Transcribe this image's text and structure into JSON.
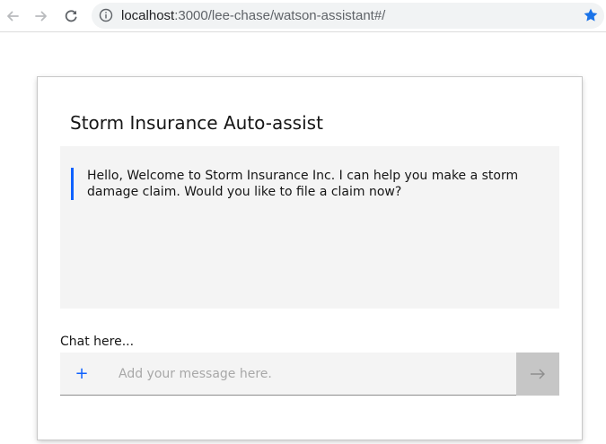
{
  "browser": {
    "url_host": "localhost",
    "url_path": ":3000/lee-chase/watson-assistant#/",
    "icons": {
      "back": "arrow-left-icon",
      "forward": "arrow-right-icon",
      "reload": "reload-icon",
      "info": "info-icon",
      "bookmark": "star-icon"
    }
  },
  "assistant": {
    "title": "Storm Insurance Auto-assist",
    "messages": [
      {
        "from": "bot",
        "text": "Hello, Welcome to Storm Insurance Inc. I can help you make a storm damage claim. Would you like to file a claim now?"
      }
    ],
    "chat_label": "Chat here...",
    "input": {
      "placeholder": "Add your message here.",
      "value": "",
      "add_symbol": "+"
    }
  },
  "colors": {
    "accent": "#0f62fe",
    "panel": "#f4f4f4",
    "send_button": "#c6c6c6",
    "bookmark_star": "#1a73e8"
  }
}
